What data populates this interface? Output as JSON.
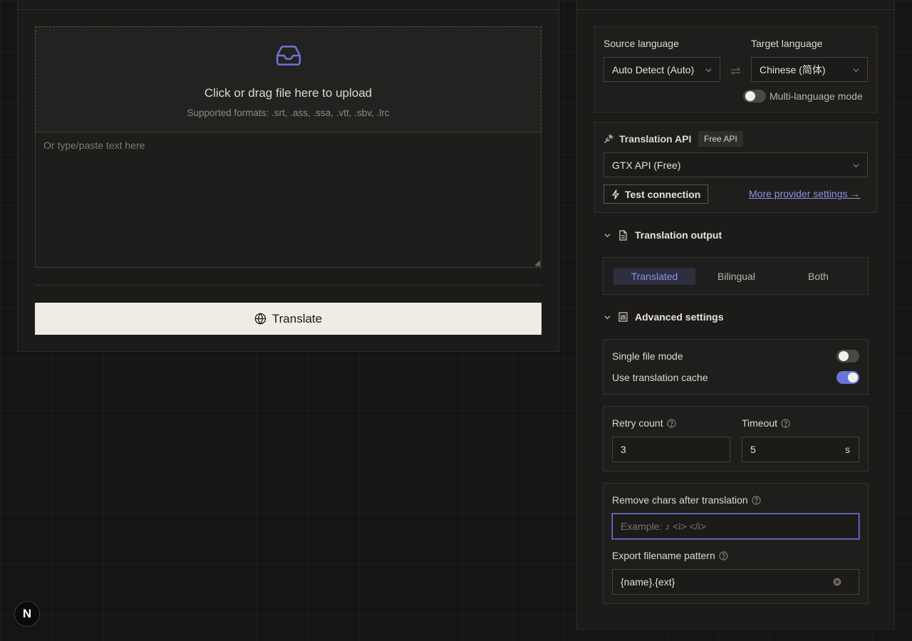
{
  "upload": {
    "title": "Click or drag file here to upload",
    "formats": "Supported formats: .srt, .ass, .ssa, .vtt, .sbv, .lrc"
  },
  "text_input": {
    "placeholder": "Or type/paste text here",
    "value": ""
  },
  "translate_button": {
    "label": "Translate"
  },
  "languages": {
    "source_label": "Source language",
    "source_value": "Auto Detect (Auto)",
    "target_label": "Target language",
    "target_value": "Chinese (简体)",
    "multi_mode_label": "Multi-language mode",
    "multi_mode_on": false
  },
  "api": {
    "title": "Translation API",
    "badge": "Free API",
    "provider": "GTX API (Free)",
    "test_label": "Test connection",
    "more_link": "More provider settings →"
  },
  "output": {
    "title": "Translation output",
    "options": [
      "Translated",
      "Bilingual",
      "Both"
    ],
    "selected": "Translated"
  },
  "advanced": {
    "title": "Advanced settings",
    "single_file_label": "Single file mode",
    "single_file_on": false,
    "cache_label": "Use translation cache",
    "cache_on": true,
    "retry_label": "Retry count",
    "retry_value": "3",
    "timeout_label": "Timeout",
    "timeout_value": "5",
    "timeout_unit": "s",
    "remove_label": "Remove chars after translation",
    "remove_placeholder": "Example: ♪ <i> </i>",
    "export_label": "Export filename pattern",
    "export_value": "{name}.{ext}"
  },
  "fab": {
    "label": "N"
  },
  "colors": {
    "accent": "#6b74d6",
    "link": "#8c93e6",
    "background": "#161513",
    "panel": "#1c1b19"
  }
}
